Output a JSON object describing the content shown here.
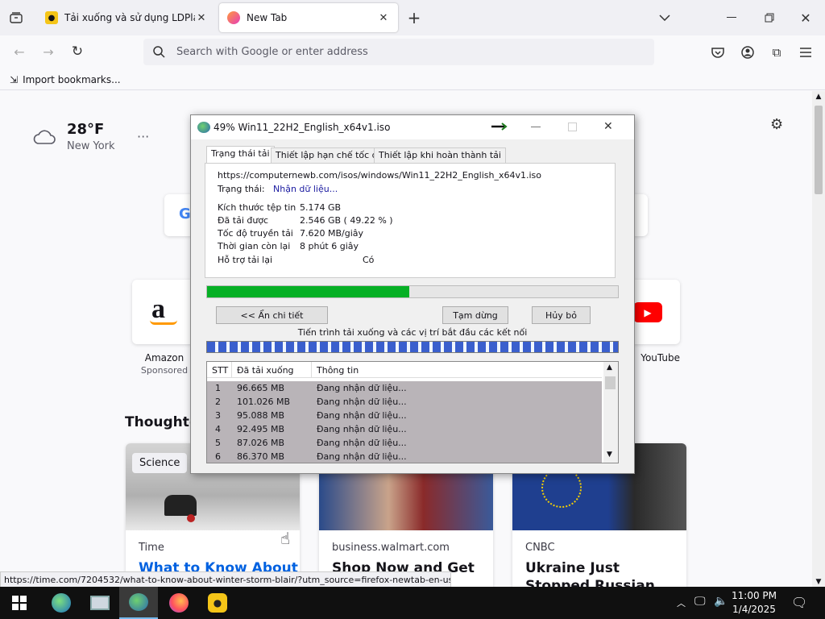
{
  "tabs": [
    {
      "title": "Tải xuống và sử dụng LDPlayer"
    },
    {
      "title": "New Tab"
    }
  ],
  "url_placeholder": "Search with Google or enter address",
  "bookmarks": {
    "import_label": "Import bookmarks..."
  },
  "weather": {
    "temp": "28°F",
    "city": "New York"
  },
  "shortcuts": [
    {
      "name": "Amazon",
      "sub": "Sponsored"
    },
    {
      "name": "YouTube"
    }
  ],
  "section_title": "Thought-p",
  "stories": [
    {
      "source": "Time",
      "headline": "What to Know About",
      "badge": "Science"
    },
    {
      "source": "business.walmart.com",
      "headline": "Shop Now and Get up"
    },
    {
      "source": "CNBC",
      "headline": "Ukraine Just Stopped Russian Gas Flows to"
    }
  ],
  "status_url": "https://time.com/7204532/what-to-know-about-winter-storm-blair/?utm_source=firefox-newtab-en-us",
  "dialog": {
    "title": "49% Win11_22H2_English_x64v1.iso",
    "progress": 0.4922,
    "tabs": [
      "Trạng thái tải",
      "Thiết lập hạn chế tốc độ",
      "Thiết lập khi hoàn thành tải"
    ],
    "url": "https://computernewb.com/isos/windows/Win11_22H2_English_x64v1.iso",
    "status_label": "Trạng thái:",
    "status_value": "Nhận dữ liệu...",
    "fields": [
      {
        "label": "Kích thước tệp tin",
        "value": "5.174  GB"
      },
      {
        "label": "Đã tải được",
        "value": "2.546  GB  ( 49.22 % )"
      },
      {
        "label": "Tốc độ truyền tải",
        "value": "7.620  MB/giây"
      },
      {
        "label": "Thời gian còn lại",
        "value": "8 phút 6 giây"
      },
      {
        "label": "Hỗ trợ tải lại",
        "value": "Có"
      }
    ],
    "btn_details": "<< Ẩn chi tiết",
    "btn_pause": "Tạm dừng",
    "btn_cancel": "Hủy bỏ",
    "segments_caption": "Tiến trình tải xuống và các vị trí bắt đầu các kết nối",
    "columns": [
      "STT",
      "Đã tải xuống",
      "Thông tin"
    ],
    "rows": [
      [
        "1",
        "96.665  MB",
        "Đang nhận dữ liệu..."
      ],
      [
        "2",
        "101.026  MB",
        "Đang nhận dữ liệu..."
      ],
      [
        "3",
        "95.088  MB",
        "Đang nhận dữ liệu..."
      ],
      [
        "4",
        "92.495  MB",
        "Đang nhận dữ liệu..."
      ],
      [
        "5",
        "87.026  MB",
        "Đang nhận dữ liệu..."
      ],
      [
        "6",
        "86.370  MB",
        "Đang nhận dữ liệu..."
      ]
    ]
  },
  "clock": {
    "time": "11:00 PM",
    "date": "1/4/2025"
  }
}
